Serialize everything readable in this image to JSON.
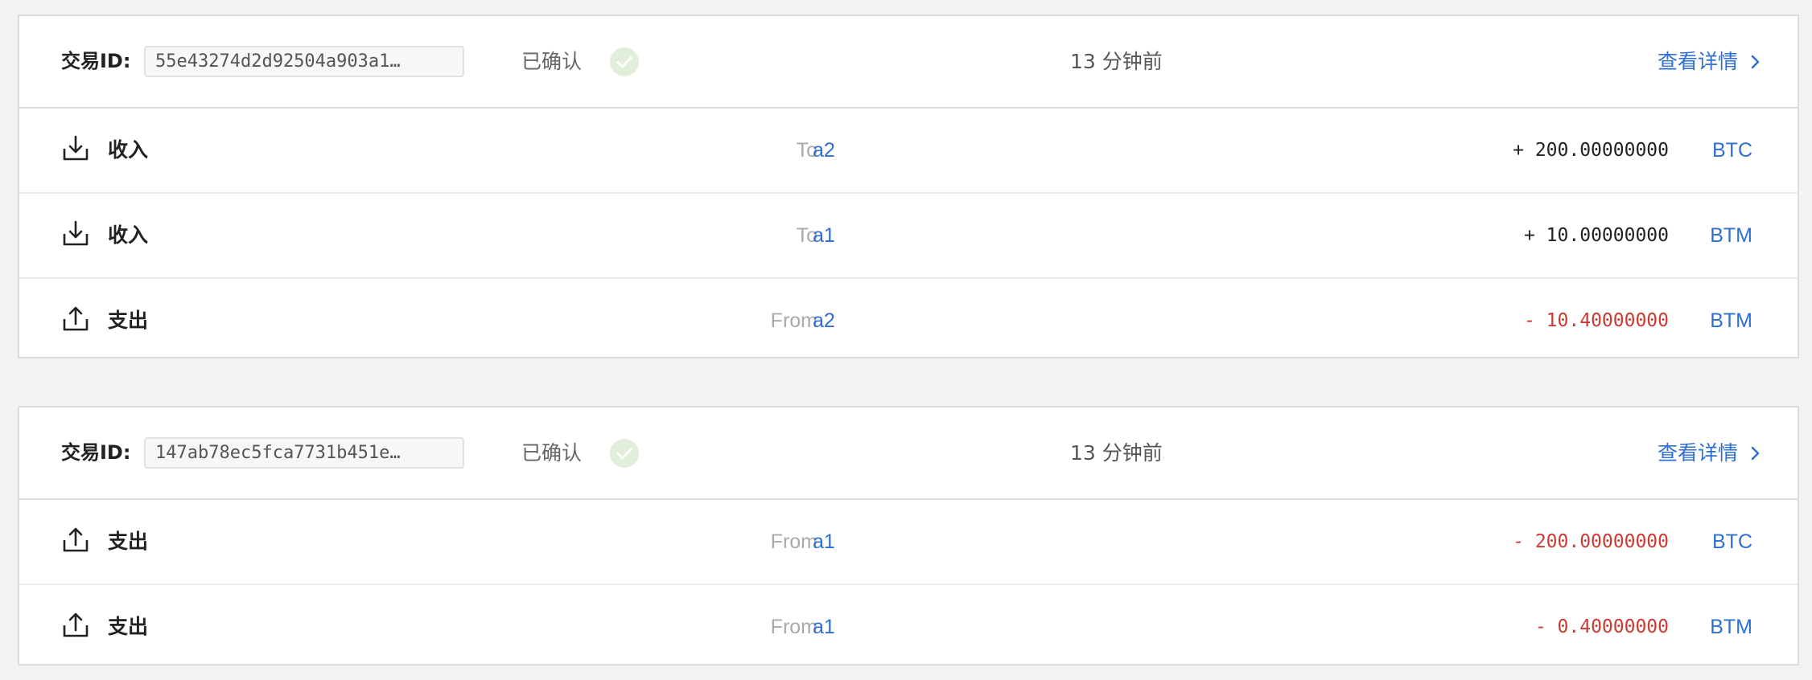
{
  "colors": {
    "link": "#2f6fd0",
    "negative": "#cc3b33",
    "confirmed_badge": "#e1eed9"
  },
  "transactions": [
    {
      "id_label": "交易ID:",
      "id_value": "55e43274d2d92504a903a1…",
      "status": "已确认",
      "time": "13 分钟前",
      "details_link": "查看详情",
      "rows": [
        {
          "type_icon": "download-icon",
          "type_label": "收入",
          "direction": "To",
          "account": "a2",
          "amount": "+ 200.00000000",
          "unit": "BTC"
        },
        {
          "type_icon": "download-icon",
          "type_label": "收入",
          "direction": "To",
          "account": "a1",
          "amount": "+ 10.00000000",
          "unit": "BTM"
        },
        {
          "type_icon": "upload-icon",
          "type_label": "支出",
          "direction": "From",
          "account": "a2",
          "amount": "- 10.40000000",
          "unit": "BTM"
        }
      ]
    },
    {
      "id_label": "交易ID:",
      "id_value": "147ab78ec5fca7731b451e…",
      "status": "已确认",
      "time": "13 分钟前",
      "details_link": "查看详情",
      "rows": [
        {
          "type_icon": "upload-icon",
          "type_label": "支出",
          "direction": "From",
          "account": "a1",
          "amount": "- 200.00000000",
          "unit": "BTC"
        },
        {
          "type_icon": "upload-icon",
          "type_label": "支出",
          "direction": "From",
          "account": "a1",
          "amount": "- 0.40000000",
          "unit": "BTM"
        }
      ]
    }
  ]
}
